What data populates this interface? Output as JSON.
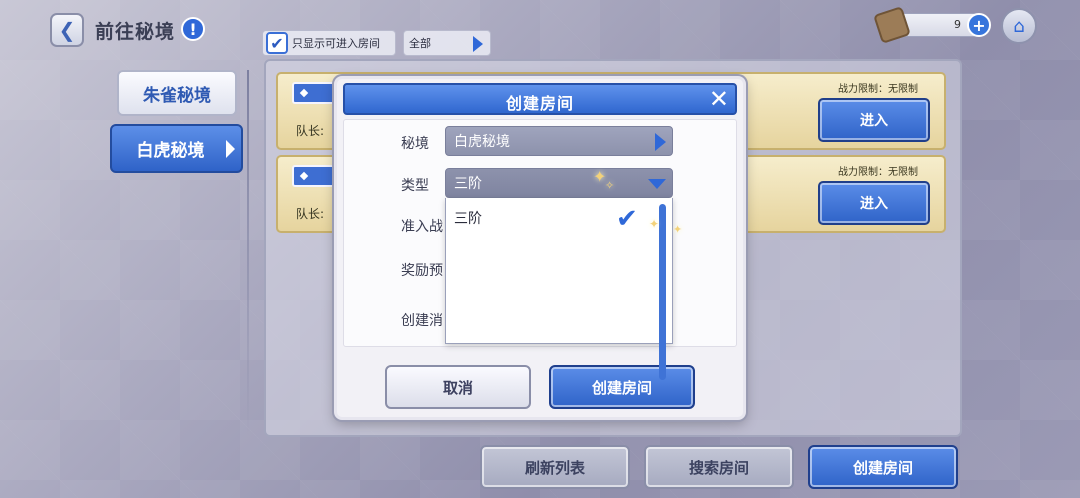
{
  "header": {
    "back_icon": "chevron-left-icon",
    "title": "前往秘境",
    "info_icon": "exclamation-icon",
    "info_glyph": "!",
    "filter_checkbox_label": "只显示可进入房间",
    "filter_checked": true,
    "filter_select_value": "全部",
    "currency_icon": "scroll-icon",
    "currency_count": "9",
    "plus_glyph": "+",
    "home_icon": "home-icon"
  },
  "tabs": [
    {
      "label": "朱雀秘境",
      "active": false
    },
    {
      "label": "白虎秘境",
      "active": true
    }
  ],
  "rooms": [
    {
      "leader_label": "队长:",
      "power_limit": "战力限制：无限制",
      "enter_label": "进入"
    },
    {
      "leader_label": "队长:",
      "power_limit": "战力限制：无限制",
      "enter_label": "进入"
    }
  ],
  "bottom_buttons": {
    "refresh": "刷新列表",
    "search": "搜索房间",
    "create": "创建房间"
  },
  "modal": {
    "title": "创建房间",
    "close_glyph": "✕",
    "labels": {
      "realm": "秘境",
      "type": "类型",
      "power": "准入战",
      "reward": "奖励预",
      "cost": "创建消"
    },
    "realm_value": "白虎秘境",
    "type_value": "三阶",
    "dropdown_options": [
      "三阶"
    ],
    "selected_option": "三阶",
    "cancel_label": "取消",
    "create_label": "创建房间"
  },
  "colors": {
    "accent_blue": "#3067cf",
    "card_gold": "#e6d49e"
  }
}
